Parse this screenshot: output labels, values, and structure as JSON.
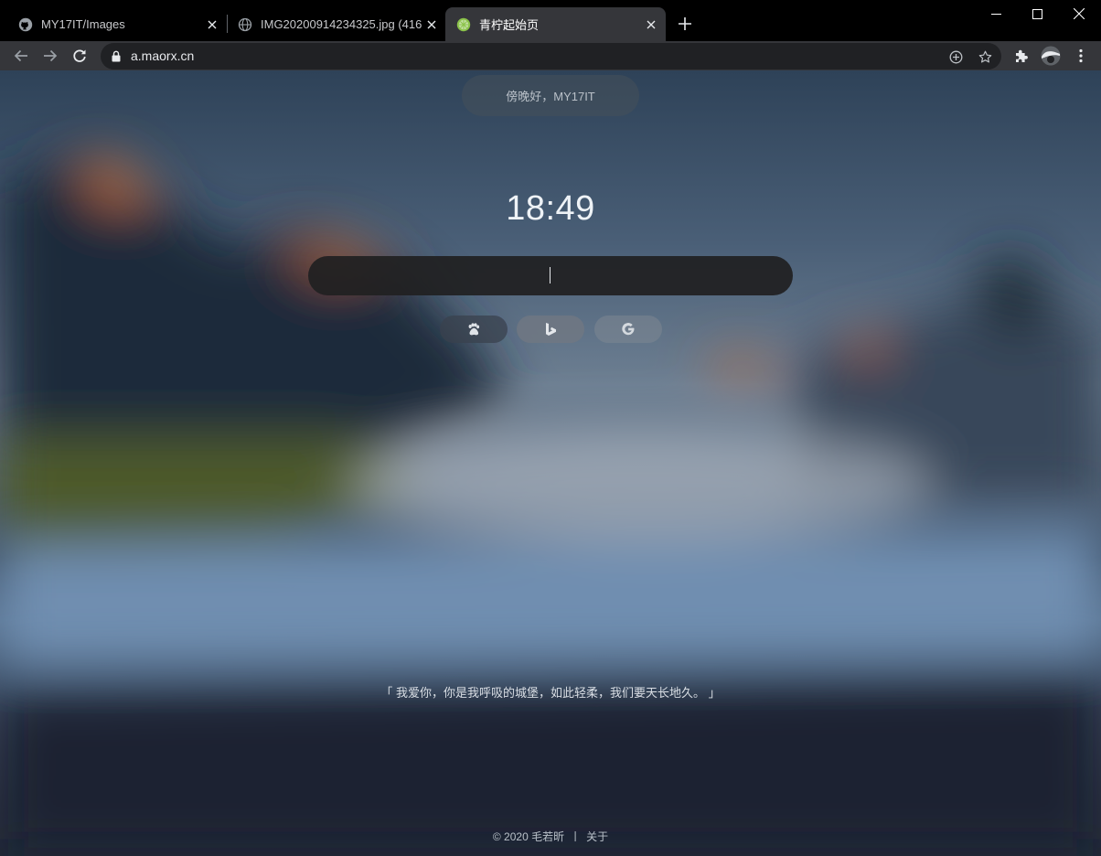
{
  "tabs": [
    {
      "title": "MY17IT/Images",
      "icon": "github-icon",
      "active": false
    },
    {
      "title": "IMG20200914234325.jpg (416",
      "icon": "globe-icon",
      "active": false
    },
    {
      "title": "青柠起始页",
      "icon": "lime-icon",
      "active": true
    }
  ],
  "address_bar": {
    "url": "a.maorx.cn"
  },
  "page": {
    "greeting": "傍晚好，MY17IT",
    "time": "18:49",
    "search": {
      "value": ""
    },
    "engines": [
      {
        "name": "baidu",
        "icon": "paw-icon",
        "selected": false
      },
      {
        "name": "bing",
        "icon": "bing-icon",
        "selected": true
      },
      {
        "name": "google",
        "icon": "google-icon",
        "selected": false
      }
    ],
    "quote": "「 我爱你，你是我呼吸的城堡，如此轻柔，我们要天长地久。 」",
    "footer": {
      "copyright": "© 2020 毛若昕",
      "separator": "丨",
      "about": "关于"
    }
  },
  "colors": {
    "tab_strip": "#000000",
    "toolbar": "#35363a",
    "omnibox": "#202124",
    "lime": "#8bc34a"
  }
}
